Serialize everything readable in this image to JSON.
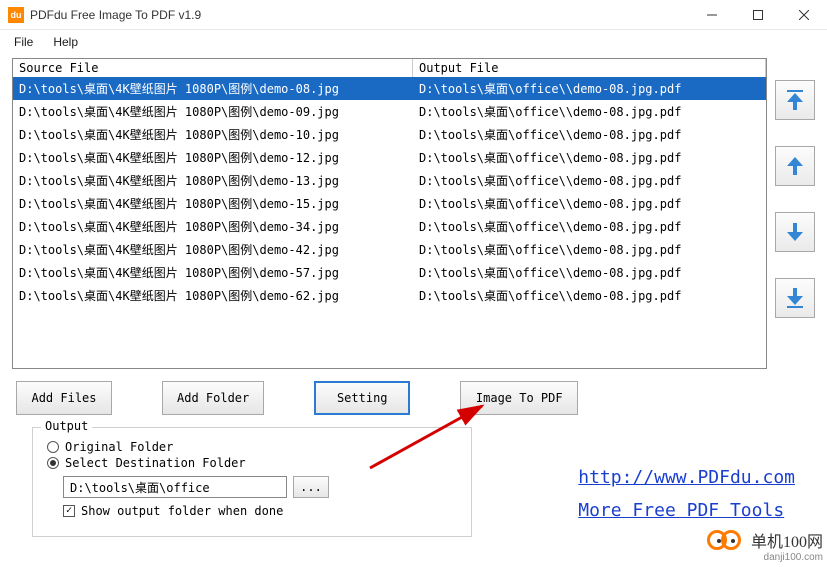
{
  "window": {
    "title": "PDFdu Free Image To PDF  v1.9",
    "icon_text": "du"
  },
  "menu": {
    "file": "File",
    "help": "Help"
  },
  "table": {
    "header_source": "Source File",
    "header_output": "Output File",
    "rows": [
      {
        "source": "D:\\tools\\桌面\\4K壁纸图片 1080P\\图例\\demo-08.jpg",
        "output": "D:\\tools\\桌面\\office\\\\demo-08.jpg.pdf",
        "selected": true
      },
      {
        "source": "D:\\tools\\桌面\\4K壁纸图片 1080P\\图例\\demo-09.jpg",
        "output": "D:\\tools\\桌面\\office\\\\demo-08.jpg.pdf",
        "selected": false
      },
      {
        "source": "D:\\tools\\桌面\\4K壁纸图片 1080P\\图例\\demo-10.jpg",
        "output": "D:\\tools\\桌面\\office\\\\demo-08.jpg.pdf",
        "selected": false
      },
      {
        "source": "D:\\tools\\桌面\\4K壁纸图片 1080P\\图例\\demo-12.jpg",
        "output": "D:\\tools\\桌面\\office\\\\demo-08.jpg.pdf",
        "selected": false
      },
      {
        "source": "D:\\tools\\桌面\\4K壁纸图片 1080P\\图例\\demo-13.jpg",
        "output": "D:\\tools\\桌面\\office\\\\demo-08.jpg.pdf",
        "selected": false
      },
      {
        "source": "D:\\tools\\桌面\\4K壁纸图片 1080P\\图例\\demo-15.jpg",
        "output": "D:\\tools\\桌面\\office\\\\demo-08.jpg.pdf",
        "selected": false
      },
      {
        "source": "D:\\tools\\桌面\\4K壁纸图片 1080P\\图例\\demo-34.jpg",
        "output": "D:\\tools\\桌面\\office\\\\demo-08.jpg.pdf",
        "selected": false
      },
      {
        "source": "D:\\tools\\桌面\\4K壁纸图片 1080P\\图例\\demo-42.jpg",
        "output": "D:\\tools\\桌面\\office\\\\demo-08.jpg.pdf",
        "selected": false
      },
      {
        "source": "D:\\tools\\桌面\\4K壁纸图片 1080P\\图例\\demo-57.jpg",
        "output": "D:\\tools\\桌面\\office\\\\demo-08.jpg.pdf",
        "selected": false
      },
      {
        "source": "D:\\tools\\桌面\\4K壁纸图片 1080P\\图例\\demo-62.jpg",
        "output": "D:\\tools\\桌面\\office\\\\demo-08.jpg.pdf",
        "selected": false
      }
    ]
  },
  "buttons": {
    "add_files": "Add Files",
    "add_folder": "Add Folder",
    "setting": "Setting",
    "image_to_pdf": "Image To PDF",
    "browse": "..."
  },
  "output": {
    "legend": "Output",
    "radio_original": "Original Folder",
    "radio_destination": "Select Destination Folder",
    "path_value": "D:\\tools\\桌面\\office",
    "show_when_done": "Show output folder when done"
  },
  "links": {
    "url": "http://www.PDFdu.com",
    "more": "More Free PDF Tools"
  },
  "watermark": {
    "text": "单机100网",
    "sub": "danji100.com"
  }
}
